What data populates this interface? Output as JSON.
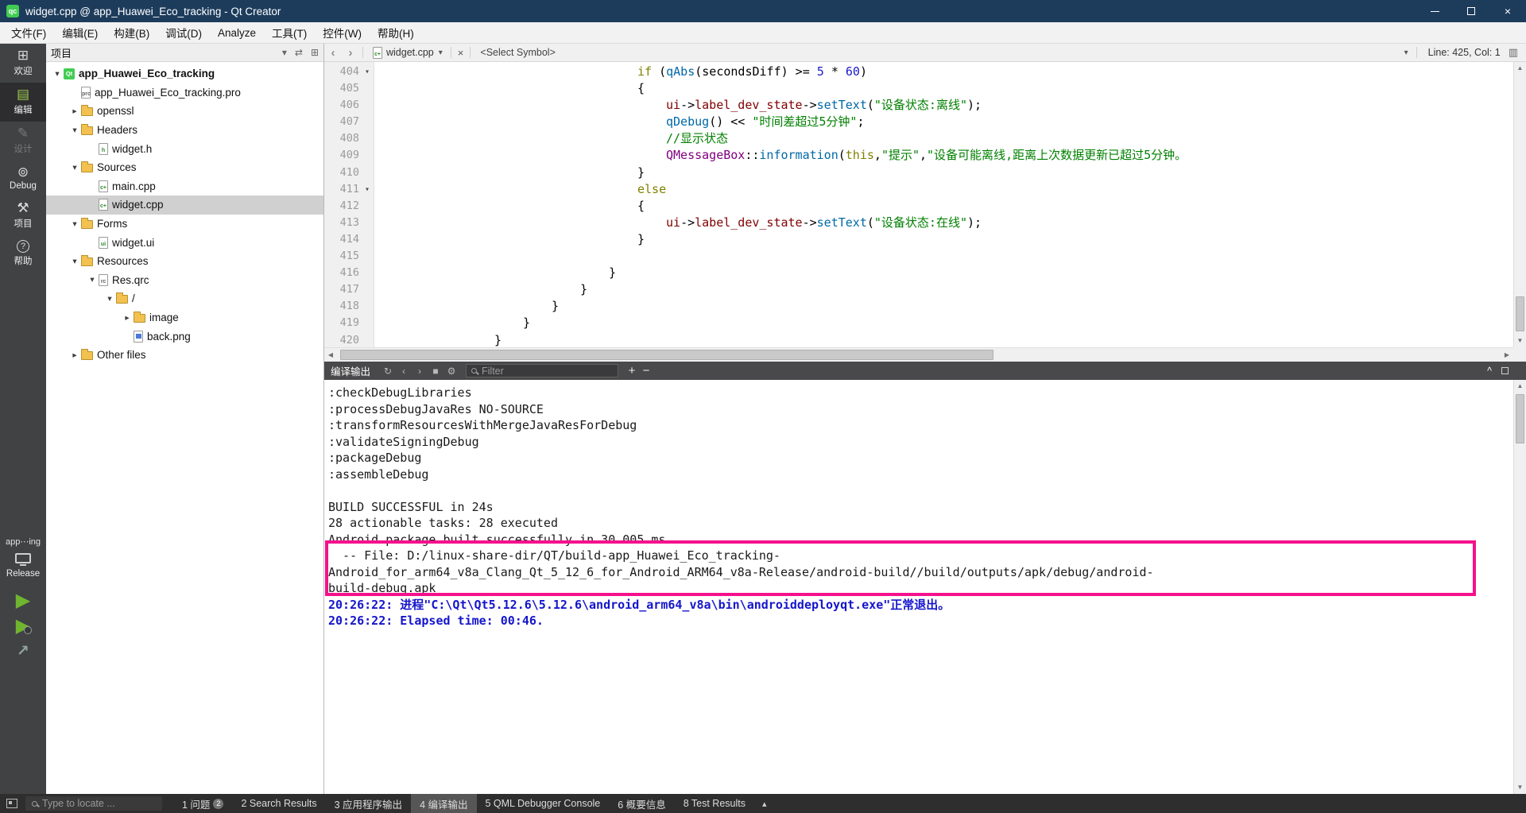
{
  "colors": {
    "titlebar": "#1d3c5c",
    "qt_green": "#41cd52",
    "highlight_pink": "#f5108c"
  },
  "titlebar": {
    "title": "widget.cpp @ app_Huawei_Eco_tracking - Qt Creator",
    "logo_text": "qc"
  },
  "menubar": {
    "items": [
      "文件(F)",
      "编辑(E)",
      "构建(B)",
      "调试(D)",
      "Analyze",
      "工具(T)",
      "控件(W)",
      "帮助(H)"
    ]
  },
  "icons": {
    "back": "‹",
    "forward": "›",
    "dropdown": "▾",
    "close": "×",
    "split_editor": "▥",
    "rerun": "↻",
    "previous": "‹",
    "next": "›",
    "stop": "■",
    "settings": "⚙",
    "plus": "+",
    "minus": "−",
    "collapse": "^",
    "panes_menu": "▴",
    "scroll_up": "▲",
    "scroll_down": "▼",
    "scroll_left": "◀",
    "scroll_right": "▶",
    "filter_funnel": "▾",
    "sync_editor": "⇄",
    "split_pane": "⊞"
  },
  "mode_sidebar": {
    "modes": [
      {
        "name": "welcome",
        "label": "欢迎",
        "glyph": "⊞",
        "state": "normal"
      },
      {
        "name": "edit",
        "label": "编辑",
        "glyph": "▤",
        "state": "active"
      },
      {
        "name": "design",
        "label": "设计",
        "glyph": "✎",
        "state": "disabled"
      },
      {
        "name": "debug",
        "label": "Debug",
        "glyph": "⊚",
        "state": "normal"
      },
      {
        "name": "projects",
        "label": "项目",
        "glyph": "⚒",
        "state": "normal"
      },
      {
        "name": "help",
        "label": "帮助",
        "glyph": "?",
        "circled": true,
        "state": "normal"
      }
    ],
    "kit_label": "app⋯ing",
    "build_config": "Release"
  },
  "project_panel": {
    "title": "项目",
    "tree": [
      {
        "label": "app_Huawei_Eco_tracking",
        "level": 0,
        "chevron": "expanded",
        "icon": "project",
        "bold": true
      },
      {
        "label": "app_Huawei_Eco_tracking.pro",
        "level": 1,
        "chevron": "none",
        "icon": "file-pro"
      },
      {
        "label": "openssl",
        "level": 1,
        "chevron": "collapsed",
        "icon": "folder"
      },
      {
        "label": "Headers",
        "level": 1,
        "chevron": "expanded",
        "icon": "folder"
      },
      {
        "label": "widget.h",
        "level": 2,
        "chevron": "none",
        "icon": "file-h"
      },
      {
        "label": "Sources",
        "level": 1,
        "chevron": "expanded",
        "icon": "folder"
      },
      {
        "label": "main.cpp",
        "level": 2,
        "chevron": "none",
        "icon": "file-cpp"
      },
      {
        "label": "widget.cpp",
        "level": 2,
        "chevron": "none",
        "icon": "file-cpp",
        "selected": true
      },
      {
        "label": "Forms",
        "level": 1,
        "chevron": "expanded",
        "icon": "folder"
      },
      {
        "label": "widget.ui",
        "level": 2,
        "chevron": "none",
        "icon": "file-ui"
      },
      {
        "label": "Resources",
        "level": 1,
        "chevron": "expanded",
        "icon": "folder"
      },
      {
        "label": "Res.qrc",
        "level": 2,
        "chevron": "expanded",
        "icon": "file-qrc"
      },
      {
        "label": "/",
        "level": 3,
        "chevron": "expanded",
        "icon": "folder"
      },
      {
        "label": "image",
        "level": 4,
        "chevron": "collapsed",
        "icon": "prefix"
      },
      {
        "label": "back.png",
        "level": 4,
        "chevron": "none",
        "icon": "file-img"
      },
      {
        "label": "Other files",
        "level": 1,
        "chevron": "collapsed",
        "icon": "folder"
      }
    ]
  },
  "editor": {
    "toolbar": {
      "file_tab": "widget.cpp",
      "symbol_selector": "<Select Symbol>",
      "cursor_position": "Line: 425, Col: 1"
    },
    "lines": [
      {
        "num": 404,
        "fold": true,
        "indent": 36,
        "segs": [
          [
            "kw",
            "if"
          ],
          [
            "p",
            " ("
          ],
          [
            "fn",
            "qAbs"
          ],
          [
            "p",
            "(secondsDiff) >= "
          ],
          [
            "num",
            "5"
          ],
          [
            "p",
            " * "
          ],
          [
            "num",
            "60"
          ],
          [
            "p",
            ")"
          ]
        ]
      },
      {
        "num": 405,
        "indent": 36,
        "segs": [
          [
            "p",
            "{"
          ]
        ]
      },
      {
        "num": 406,
        "indent": 40,
        "segs": [
          [
            "fld",
            "ui"
          ],
          [
            "p",
            "->"
          ],
          [
            "fld",
            "label_dev_state"
          ],
          [
            "p",
            "->"
          ],
          [
            "fn",
            "setText"
          ],
          [
            "p",
            "("
          ],
          [
            "str",
            "\"设备状态:离线\""
          ],
          [
            "p",
            ");"
          ]
        ]
      },
      {
        "num": 407,
        "indent": 40,
        "segs": [
          [
            "fn",
            "qDebug"
          ],
          [
            "p",
            "() << "
          ],
          [
            "str",
            "\"时间差超过5分钟\""
          ],
          [
            "p",
            ";"
          ]
        ]
      },
      {
        "num": 408,
        "indent": 40,
        "segs": [
          [
            "cmt",
            "//显示状态"
          ]
        ]
      },
      {
        "num": 409,
        "indent": 40,
        "segs": [
          [
            "typ",
            "QMessageBox"
          ],
          [
            "p",
            "::"
          ],
          [
            "fn",
            "information"
          ],
          [
            "p",
            "("
          ],
          [
            "kw",
            "this"
          ],
          [
            "p",
            ","
          ],
          [
            "str",
            "\"提示\""
          ],
          [
            "p",
            ","
          ],
          [
            "str",
            "\"设备可能离线,距离上次数据更新已超过5分钟。"
          ]
        ]
      },
      {
        "num": 410,
        "indent": 36,
        "segs": [
          [
            "p",
            "}"
          ]
        ]
      },
      {
        "num": 411,
        "fold": true,
        "indent": 36,
        "segs": [
          [
            "kw",
            "else"
          ]
        ]
      },
      {
        "num": 412,
        "indent": 36,
        "segs": [
          [
            "p",
            "{"
          ]
        ]
      },
      {
        "num": 413,
        "indent": 40,
        "segs": [
          [
            "fld",
            "ui"
          ],
          [
            "p",
            "->"
          ],
          [
            "fld",
            "label_dev_state"
          ],
          [
            "p",
            "->"
          ],
          [
            "fn",
            "setText"
          ],
          [
            "p",
            "("
          ],
          [
            "str",
            "\"设备状态:在线\""
          ],
          [
            "p",
            ");"
          ]
        ]
      },
      {
        "num": 414,
        "indent": 36,
        "segs": [
          [
            "p",
            "}"
          ]
        ]
      },
      {
        "num": 415,
        "indent": 0,
        "segs": []
      },
      {
        "num": 416,
        "indent": 32,
        "segs": [
          [
            "p",
            "}"
          ]
        ]
      },
      {
        "num": 417,
        "indent": 28,
        "segs": [
          [
            "p",
            "}"
          ]
        ]
      },
      {
        "num": 418,
        "indent": 24,
        "segs": [
          [
            "p",
            "}"
          ]
        ]
      },
      {
        "num": 419,
        "indent": 20,
        "segs": [
          [
            "p",
            "}"
          ]
        ]
      },
      {
        "num": 420,
        "indent": 16,
        "segs": [
          [
            "p",
            "}"
          ]
        ]
      }
    ]
  },
  "output_pane": {
    "title": "编译输出",
    "filter_placeholder": "Filter",
    "highlight_color": "#f5108c",
    "lines": [
      {
        "text": ":checkDebugLibraries",
        "style": "plain"
      },
      {
        "text": ":processDebugJavaRes NO-SOURCE",
        "style": "plain"
      },
      {
        "text": ":transformResourcesWithMergeJavaResForDebug",
        "style": "plain"
      },
      {
        "text": ":validateSigningDebug",
        "style": "plain"
      },
      {
        "text": ":packageDebug",
        "style": "plain"
      },
      {
        "text": ":assembleDebug",
        "style": "plain"
      },
      {
        "text": "",
        "style": "plain"
      },
      {
        "text": "BUILD SUCCESSFUL in 24s",
        "style": "plain"
      },
      {
        "text": "28 actionable tasks: 28 executed",
        "style": "plain"
      },
      {
        "text": "Android package built successfully in 30.005 ms.",
        "style": "plain"
      },
      {
        "text": "  -- File: D:/linux-share-dir/QT/build-app_Huawei_Eco_tracking-",
        "style": "plain"
      },
      {
        "text": "Android_for_arm64_v8a_Clang_Qt_5_12_6_for_Android_ARM64_v8a-Release/android-build//build/outputs/apk/debug/android-",
        "style": "plain"
      },
      {
        "text": "build-debug.apk",
        "style": "plain"
      },
      {
        "text": "20:26:22: 进程\"C:\\Qt\\Qt5.12.6\\5.12.6\\android_arm64_v8a\\bin\\androiddeployqt.exe\"正常退出。",
        "style": "message"
      },
      {
        "text": "20:26:22: Elapsed time: 00:46.",
        "style": "message"
      }
    ]
  },
  "status_bar": {
    "locator_placeholder": "Type to locate ...",
    "panes": [
      {
        "label": "1 问题",
        "badge": "2"
      },
      {
        "label": "2 Search Results"
      },
      {
        "label": "3 应用程序输出"
      },
      {
        "label": "4 编译输出",
        "active": true
      },
      {
        "label": "5 QML Debugger Console"
      },
      {
        "label": "6 概要信息"
      },
      {
        "label": "8 Test Results"
      }
    ]
  }
}
